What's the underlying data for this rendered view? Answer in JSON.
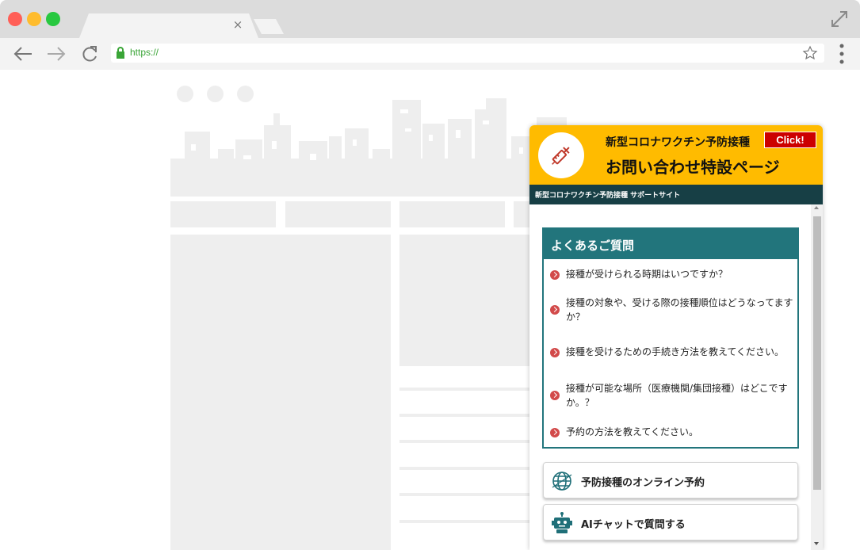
{
  "browser": {
    "url": "https://",
    "tab_close": "×"
  },
  "widget": {
    "title_small": "新型コロナワクチン予防接種",
    "title_large": "お問い合わせ特設ページ",
    "click_label": "Click!",
    "subbar": "新型コロナワクチン予防接種 サポートサイト",
    "faq": {
      "heading": "よくあるご質問",
      "items": [
        "接種が受けられる時期はいつですか？",
        "接種の対象や、受ける際の接種順位はどうなってますか？",
        "接種を受けるための手続き方法を教えてください。",
        "接種が可能な場所（医療機関/集団接種）はどこですか。？",
        "予約の方法を教えてください。"
      ]
    },
    "buttons": {
      "online_reservation": "予防接種のオンライン予約",
      "ai_chat": "AIチャットで質問する"
    }
  },
  "colors": {
    "header": "#ffbb00",
    "subbar": "#173f45",
    "faq_accent": "#22757c",
    "click_button": "#cc0000",
    "bullet": "#d24a4a",
    "wireframe": "#eeeeee"
  },
  "icons": {
    "badge": "syringe-icon",
    "online_reservation": "globe-icon",
    "ai_chat": "robot-icon"
  }
}
